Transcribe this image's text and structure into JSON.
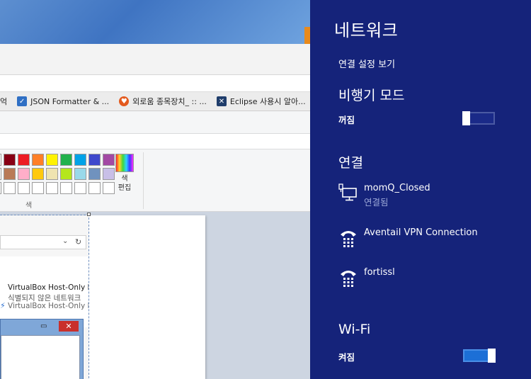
{
  "bookmarks": [
    {
      "label": "억",
      "icon": "none"
    },
    {
      "label": "JSON Formatter & ...",
      "icon": "checkbox-icon"
    },
    {
      "label": "외로움 종목장치_ :: ...",
      "icon": "orange-circle-icon"
    },
    {
      "label": "Eclipse 사용시 알아...",
      "icon": "eclipse-icon"
    }
  ],
  "paint": {
    "palette_rows": [
      [
        "#ffffff",
        "#880015",
        "#ed1c24",
        "#ff7f27",
        "#fff200",
        "#22b14c",
        "#00a2e8",
        "#3f48cc",
        "#a349a4"
      ],
      [
        "#ffffff",
        "#b97a57",
        "#ffaec9",
        "#ffc90e",
        "#efe4b0",
        "#b5e61d",
        "#99d9ea",
        "#7092be",
        "#c8bfe7"
      ],
      [
        "#ffffff",
        "#ffffff",
        "#ffffff",
        "#ffffff",
        "#ffffff",
        "#ffffff",
        "#ffffff",
        "#ffffff",
        "#ffffff"
      ]
    ],
    "color_edit_label_1": "색",
    "color_edit_label_2": "편집",
    "colors_group_label": "색"
  },
  "background_window": {
    "item_name": "VirtualBox Host-Only N",
    "item_status": "식별되지 않은 네트워크",
    "item_adapter": "VirtualBox Host-Only Et",
    "dropdown_glyph": "⌄",
    "refresh_glyph": "↻",
    "minimize_glyph": "▭",
    "close_glyph": "✕"
  },
  "network_panel": {
    "title": "네트워크",
    "view_settings": "연결 설정 보기",
    "airplane": {
      "heading": "비행기 모드",
      "state": "꺼짐",
      "on": false
    },
    "connections_heading": "연결",
    "connections": [
      {
        "name": "momQ_Closed",
        "status": "연결됨",
        "icon": "wired-network-icon"
      },
      {
        "name": "Aventail VPN Connection",
        "status": "",
        "icon": "dialup-phone-icon"
      },
      {
        "name": "fortissl",
        "status": "",
        "icon": "dialup-phone-icon"
      }
    ],
    "wifi": {
      "heading": "Wi-Fi",
      "state": "켜짐",
      "on": true
    }
  },
  "colors": {
    "panel_bg": "#15237a",
    "toggle_on": "#1c6fd6",
    "status_text": "#9aa6d6"
  }
}
